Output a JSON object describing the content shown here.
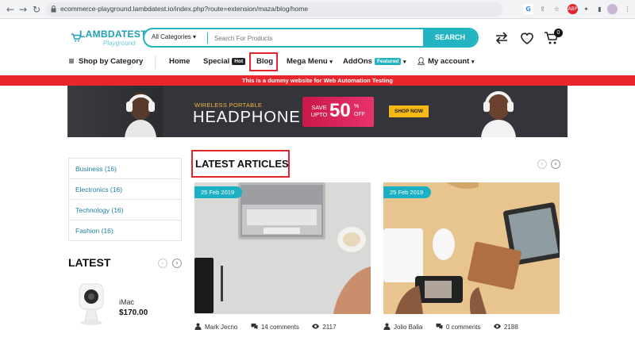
{
  "browser": {
    "url": "ecommerce-playground.lambdatest.io/index.php?route=extension/maza/blog/home"
  },
  "header": {
    "logo_main": "LAMBDATEST",
    "logo_sub": "Playground",
    "category_select": "All Categories",
    "search_placeholder": "Search For Products",
    "search_button": "SEARCH",
    "cart_count": "0"
  },
  "nav": {
    "shop_by_category": "Shop by Category",
    "items": [
      {
        "label": "Home"
      },
      {
        "label": "Special",
        "badge": "Hot"
      },
      {
        "label": "Blog"
      },
      {
        "label": "Mega Menu"
      },
      {
        "label": "AddOns",
        "badge": "Featured"
      },
      {
        "label": "My account"
      }
    ]
  },
  "notice": "This is a dummy website for Web Automation Testing",
  "banner": {
    "subtitle": "WIRELESS PORTABLE",
    "title": "HEADPHONE",
    "save_line1": "SAVE",
    "save_line2": "UPTO",
    "discount": "50",
    "pct": "%",
    "off": "OFF",
    "cta": "SHOP NOW"
  },
  "sidebar": {
    "categories": [
      {
        "label": "Business (16)"
      },
      {
        "label": "Electronics (16)"
      },
      {
        "label": "Technology (16)"
      },
      {
        "label": "Fashion (16)"
      }
    ],
    "latest_title": "LATEST",
    "product": {
      "name": "iMac",
      "price": "$170.00"
    }
  },
  "articles": {
    "title": "LATEST ARTICLES",
    "items": [
      {
        "date": "25 Feb 2019",
        "author": "Mark Jecno",
        "comments": "14 comments",
        "views": "2117"
      },
      {
        "date": "25 Feb 2019",
        "author": "Jolio Balia",
        "comments": "0 comments",
        "views": "2188"
      }
    ]
  },
  "colors": {
    "accent": "#23b4c1",
    "highlight_box": "#e0262d",
    "notice_bar": "#e8262b"
  }
}
